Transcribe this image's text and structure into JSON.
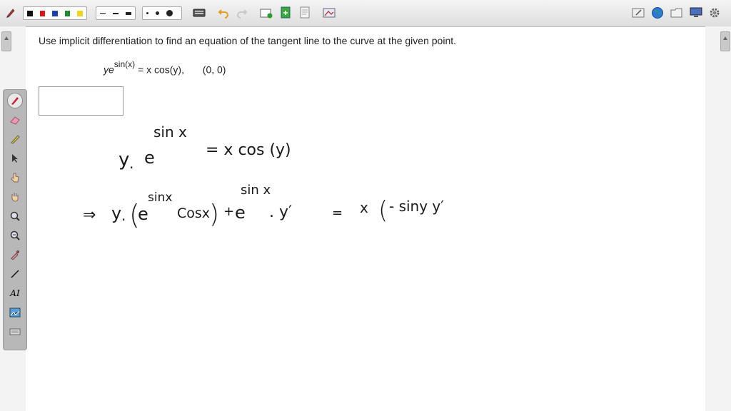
{
  "problem": {
    "instruction": "Use implicit differentiation to find an equation of the tangent line to the curve at the given point.",
    "eq_y": "y",
    "eq_exp": "sin(x)",
    "eq_rest": " = x cos(y),",
    "eq_point": "(0, 0)"
  },
  "handwriting": {
    "line1": {
      "y": "y",
      "dot": ".",
      "e": "e",
      "exp": "sin x",
      "rhs": "= x cos (y)"
    },
    "line2": {
      "implies": "⇒",
      "y": "y",
      "dot": ".",
      "open": "(",
      "e": "e",
      "exp1": "sinx",
      "cos": "Cosx",
      "close": ")",
      "plus": "+",
      "e2": "e",
      "exp2": "sin x",
      "yprime": ". y′",
      "eq": "=",
      "x": "x",
      "open2": "(",
      "rhs": "- siny y′"
    }
  },
  "colors": {
    "ink": "#1a1a1a",
    "toolbar": "#e6e6e6"
  },
  "icons": {
    "top": [
      "pen-icon",
      "color-swatches",
      "line-widths",
      "dot-sizes",
      "keyboard-icon",
      "undo-icon",
      "redo-icon",
      "new-page-icon",
      "insert-page-icon",
      "document-icon",
      "screen-capture-icon",
      "whiteboard-icon",
      "globe-icon",
      "folder-icon",
      "monitor-icon",
      "settings-icon"
    ],
    "palette": [
      "pen-icon",
      "eraser-icon",
      "highlighter-icon",
      "pointer-icon",
      "hand-pointer-icon",
      "pan-hand-icon",
      "zoom-in-icon",
      "zoom-out-icon",
      "dropper-icon",
      "line-icon",
      "text-icon",
      "image-icon",
      "keyboard-icon"
    ]
  }
}
